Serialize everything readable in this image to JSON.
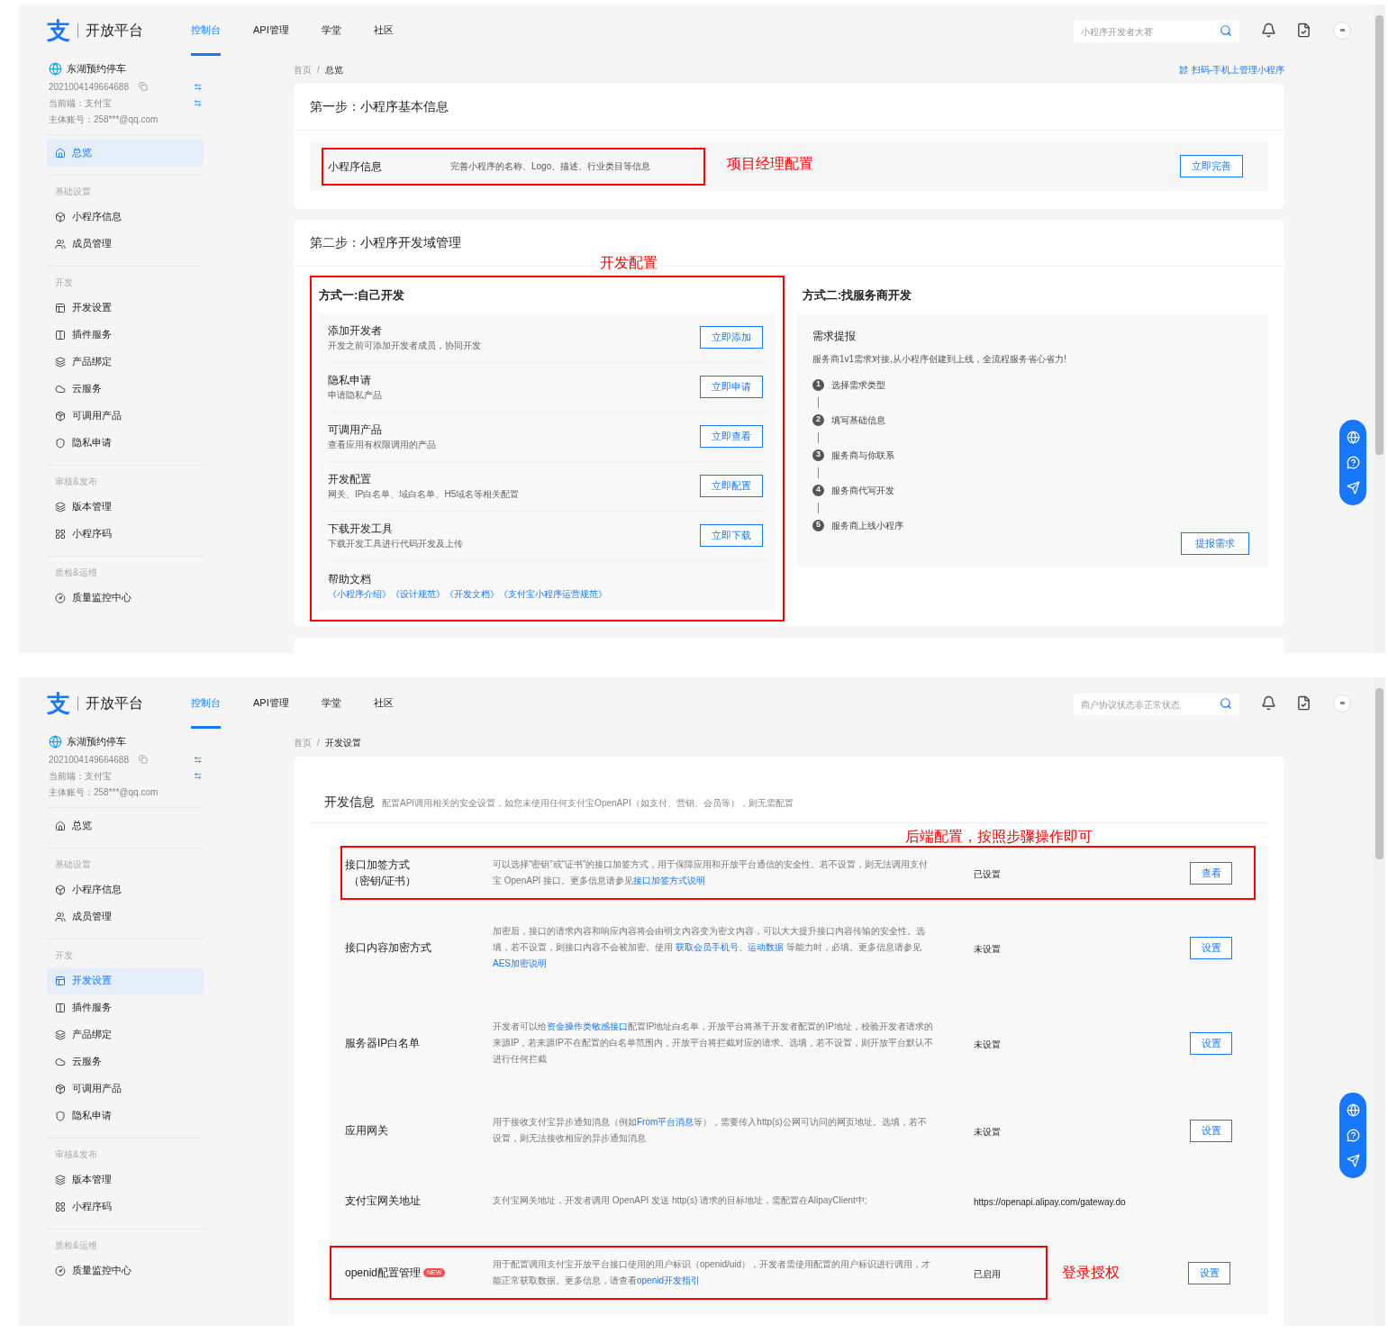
{
  "screens": [
    {
      "kind": "overview",
      "header": {
        "logo_mark": "支",
        "logo_text": "开放平台",
        "nav": [
          {
            "label": "控制台",
            "selected": true
          },
          {
            "label": "API管理",
            "selected": false
          },
          {
            "label": "学堂",
            "selected": false
          },
          {
            "label": "社区",
            "selected": false
          }
        ],
        "search": {
          "placeholder": "小程序开发者大赛"
        }
      },
      "sidebar": {
        "app_name": "东湖预约停车",
        "app_id": "2021004149664688",
        "current_end": "当前端：支付宝",
        "account": "主体账号：258***@qq.com",
        "groups": [
          {
            "items": [
              {
                "label": "总览",
                "selected": true
              }
            ]
          },
          {
            "title": "基础设置",
            "items": [
              {
                "label": "小程序信息",
                "selected": false
              },
              {
                "label": "成员管理",
                "selected": false
              }
            ]
          },
          {
            "title": "开发",
            "items": [
              {
                "label": "开发设置",
                "selected": false
              },
              {
                "label": "插件服务",
                "selected": false
              },
              {
                "label": "产品绑定",
                "selected": false
              },
              {
                "label": "云服务",
                "selected": false
              },
              {
                "label": "可调用产品",
                "selected": false
              },
              {
                "label": "隐私申请",
                "selected": false
              }
            ]
          },
          {
            "title": "审核&发布",
            "items": [
              {
                "label": "版本管理",
                "selected": false
              },
              {
                "label": "小程序码",
                "selected": false
              }
            ]
          },
          {
            "title": "质检&运维",
            "items": [
              {
                "label": "质量监控中心",
                "selected": false
              }
            ]
          }
        ]
      },
      "breadcrumb": [
        "首页",
        "总览"
      ],
      "breadcrumb_separator": "/",
      "top_link": "扫码-手机上管理小程序",
      "step1": {
        "title": "第一步：小程序基本信息",
        "name": "小程序信息",
        "desc": "完善小程序的名称、Logo、描述、行业类目等信息",
        "annotation": "项目经理配置",
        "button": "立即完善"
      },
      "step2": {
        "title": "第二步：小程序开发域管理",
        "annotation": "开发配置",
        "option1": {
          "title": "方式一:自己开发",
          "items": [
            {
              "title": "添加开发者",
              "desc": "开发之前可添加开发者成员，协同开发",
              "button": "立即添加"
            },
            {
              "title": "隐私申请",
              "desc": "申请隐私产品",
              "button": "立即申请"
            },
            {
              "title": "可调用产品",
              "desc": "查看应用有权限调用的产品",
              "button": "立即查看"
            },
            {
              "title": "开发配置",
              "desc": "网关、IP白名单、域白名单、H5域名等相关配置",
              "button": "立即配置"
            },
            {
              "title": "下载开发工具",
              "desc": "下载开发工具进行代码开发及上传",
              "button": "立即下载"
            }
          ],
          "help": {
            "title": "帮助文档",
            "links": [
              "《小程序介绍》",
              "《设计规范》",
              "《开发文档》",
              "《支付宝小程序运营规范》"
            ]
          }
        },
        "option2": {
          "title": "方式二:找服务商开发",
          "card_title": "需求提报",
          "desc": "服务商1v1需求对接,从小程序创建到上线，全流程服务省心省力!",
          "steps": [
            {
              "num": "1",
              "label": "选择需求类型"
            },
            {
              "num": "2",
              "label": "填写基础信息"
            },
            {
              "num": "3",
              "label": "服务商与你联系"
            },
            {
              "num": "4",
              "label": "服务商代写开发"
            },
            {
              "num": "5",
              "label": "服务商上线小程序"
            }
          ],
          "button": "提报需求"
        }
      }
    },
    {
      "kind": "dev_settings",
      "header": {
        "logo_mark": "支",
        "logo_text": "开放平台",
        "nav": [
          {
            "label": "控制台",
            "selected": true
          },
          {
            "label": "API管理",
            "selected": false
          },
          {
            "label": "学堂",
            "selected": false
          },
          {
            "label": "社区",
            "selected": false
          }
        ],
        "search": {
          "placeholder": "商户协议状态非正常状态"
        }
      },
      "sidebar": {
        "app_name": "东湖预约停车",
        "app_id": "2021004149664688",
        "current_end": "当前端：支付宝",
        "account": "主体账号：258***@qq.com",
        "groups": [
          {
            "items": [
              {
                "label": "总览",
                "selected": false
              }
            ]
          },
          {
            "title": "基础设置",
            "items": [
              {
                "label": "小程序信息",
                "selected": false
              },
              {
                "label": "成员管理",
                "selected": false
              }
            ]
          },
          {
            "title": "开发",
            "items": [
              {
                "label": "开发设置",
                "selected": true
              },
              {
                "label": "插件服务",
                "selected": false
              },
              {
                "label": "产品绑定",
                "selected": false
              },
              {
                "label": "云服务",
                "selected": false
              },
              {
                "label": "可调用产品",
                "selected": false
              },
              {
                "label": "隐私申请",
                "selected": false
              }
            ]
          },
          {
            "title": "审核&发布",
            "items": [
              {
                "label": "版本管理",
                "selected": false
              },
              {
                "label": "小程序码",
                "selected": false
              }
            ]
          },
          {
            "title": "质检&运维",
            "items": [
              {
                "label": "质量监控中心",
                "selected": false
              }
            ]
          }
        ]
      },
      "breadcrumb": [
        "首页",
        "开发设置"
      ],
      "breadcrumb_separator": "/",
      "dev_info": {
        "title": "开发信息",
        "desc": "配置API调用相关的安全设置，如您未使用任何支付宝OpenAPI（如支付、营销、会员等），则无需配置",
        "annotation": "后端配置，按照步骤操作即可",
        "rows": [
          {
            "name": "接口加签方式",
            "name_line2": "（密钥/证书）",
            "desc": [
              {
                "text": "可以选择“密钥”或“证书”的接口加签方式，用于保障应用和开放平台通信的安全性。若不设置，则无法调用支付宝 OpenAPI 接口。更多信息请参见"
              },
              {
                "text": "接口加签方式说明",
                "link": true
              }
            ],
            "status": "已设置",
            "button": "查看",
            "kind": "framed"
          },
          {
            "name": "接口内容加密方式",
            "desc": [
              {
                "text": "加密后，接口的请求内容和响应内容将会由明文内容变为密文内容，可以大大提升接口内容传输的安全性。选填，若不设置，则接口内容不会被加密。使用 "
              },
              {
                "text": "获取会员手机号、运动数据",
                "link": true
              },
              {
                "text": " 等能力时，必填。更多信息请参见"
              },
              {
                "text": "AES加密说明",
                "link": true
              }
            ],
            "status": "未设置",
            "button": "设置"
          },
          {
            "name": "服务器IP白名单",
            "desc": [
              {
                "text": "开发者可以给"
              },
              {
                "text": "资金操作类敏感接口",
                "link": true
              },
              {
                "text": "配置IP地址白名单，开放平台将基于开发者配置的IP地址，校验开发者请求的来源IP，若来源IP不在配置的白名单范围内，开放平台将拦截对应的请求。选填，若不设置，则开放平台默认不进行任何拦截"
              }
            ],
            "status": "未设置",
            "button": "设置"
          },
          {
            "name": "应用网关",
            "desc": [
              {
                "text": "用于接收支付宝异步通知消息（例如"
              },
              {
                "text": "From平台消息",
                "link": true
              },
              {
                "text": "等），需要传入http(s)公网可访问的网页地址。选填，若不设置，则无法接收相应的异步通知消息"
              }
            ],
            "status": "未设置",
            "button": "设置"
          },
          {
            "name": "支付宝网关地址",
            "desc": [
              {
                "text": "支付宝网关地址，开发者调用 OpenAPI 发送 http(s) 请求的目标地址，需配置在AlipayClient中;"
              }
            ],
            "status": "https://openapi.alipay.com/gateway.do"
          },
          {
            "name": "openid配置管理",
            "badge": "NEW",
            "desc": [
              {
                "text": "用于配置调用支付宝开放平台接口使用的用户标识（openid/uid），开发者需使用配置的用户标识进行调用，才能正常获取数据。更多信息，请查看"
              },
              {
                "text": "openid开发指引",
                "link": true
              }
            ],
            "status": "已启用",
            "button": "设置",
            "kind": "partframed",
            "annotation": "登录授权"
          }
        ]
      }
    }
  ]
}
